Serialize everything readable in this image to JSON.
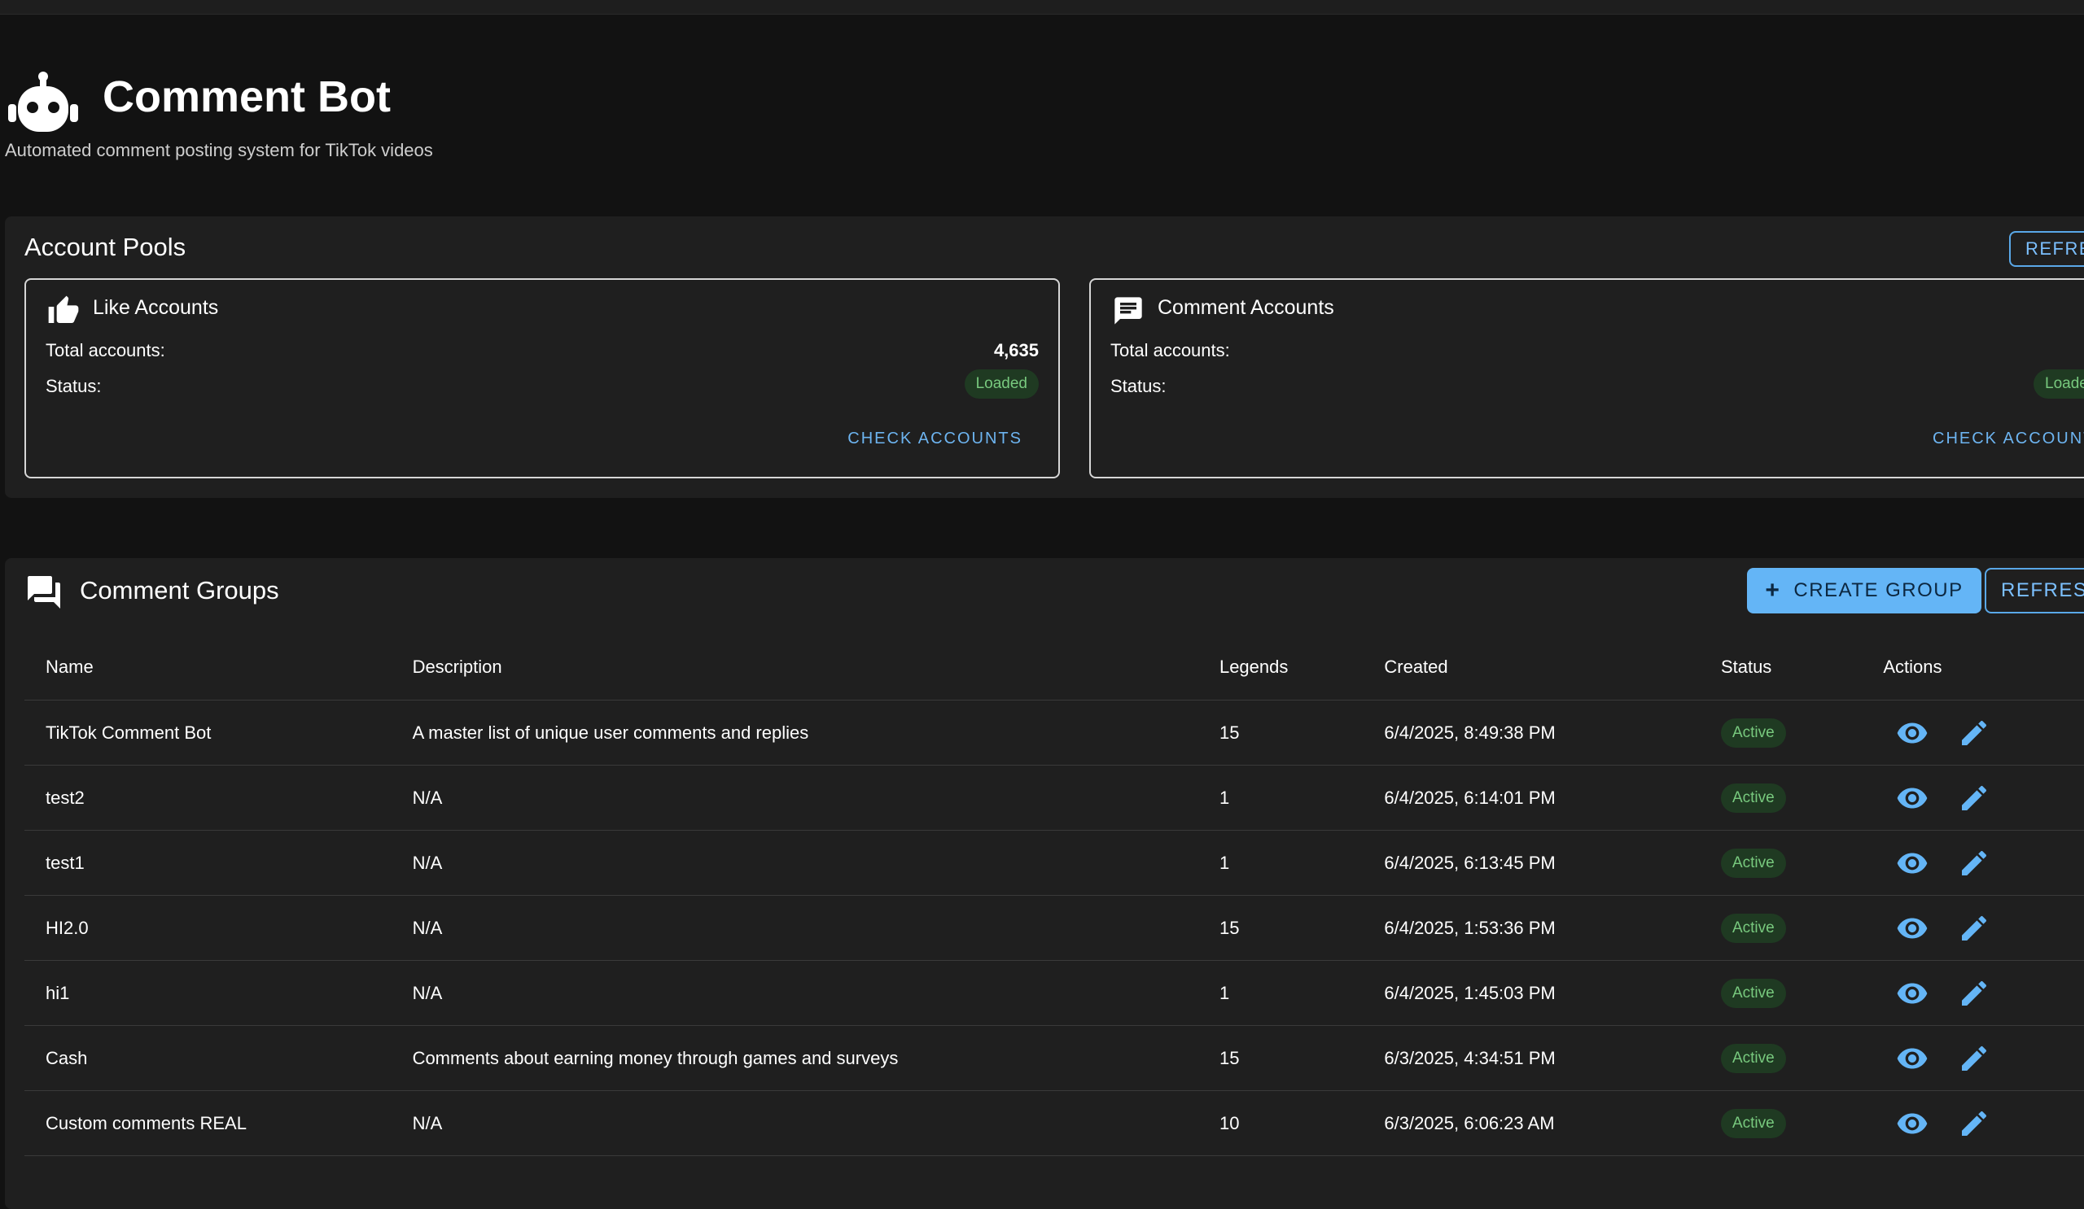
{
  "header": {
    "title": "Comment Bot",
    "subtitle": "Automated comment posting system for TikTok videos",
    "icon": "robot-icon"
  },
  "account_pools": {
    "title": "Account Pools",
    "refresh_label": "REFRESH",
    "cards": [
      {
        "icon": "thumbs-up-icon",
        "title": "Like Accounts",
        "total_label": "Total accounts:",
        "total_value": "4,635",
        "status_label": "Status:",
        "status_value": "Loaded",
        "action_label": "CHECK ACCOUNTS"
      },
      {
        "icon": "comment-icon",
        "title": "Comment Accounts",
        "total_label": "Total accounts:",
        "total_value": "",
        "status_label": "Status:",
        "status_value": "Loaded",
        "action_label": "CHECK ACCOUNTS"
      }
    ]
  },
  "comment_groups": {
    "title": "Comment Groups",
    "icon": "forum-icon",
    "create_label": "CREATE GROUP",
    "refresh_label": "REFRESH",
    "columns": [
      "Name",
      "Description",
      "Legends",
      "Created",
      "Status",
      "Actions"
    ],
    "rows": [
      {
        "name": "TikTok Comment Bot",
        "description": "A master list of unique user comments and replies",
        "legends": "15",
        "created": "6/4/2025, 8:49:38 PM",
        "status": "Active"
      },
      {
        "name": "test2",
        "description": "N/A",
        "legends": "1",
        "created": "6/4/2025, 6:14:01 PM",
        "status": "Active"
      },
      {
        "name": "test1",
        "description": "N/A",
        "legends": "1",
        "created": "6/4/2025, 6:13:45 PM",
        "status": "Active"
      },
      {
        "name": "HI2.0",
        "description": "N/A",
        "legends": "15",
        "created": "6/4/2025, 1:53:36 PM",
        "status": "Active"
      },
      {
        "name": "hi1",
        "description": "N/A",
        "legends": "1",
        "created": "6/4/2025, 1:45:03 PM",
        "status": "Active"
      },
      {
        "name": "Cash",
        "description": "Comments about earning money through games and surveys",
        "legends": "15",
        "created": "6/3/2025, 4:34:51 PM",
        "status": "Active"
      },
      {
        "name": "Custom comments REAL",
        "description": "N/A",
        "legends": "10",
        "created": "6/3/2025, 6:06:23 AM",
        "status": "Active"
      }
    ]
  },
  "colors": {
    "background": "#121212",
    "panel": "#1f1f1f",
    "accent": "#64b5f6",
    "active_badge_bg": "#1f3a22",
    "active_badge_text": "#78c97e"
  }
}
